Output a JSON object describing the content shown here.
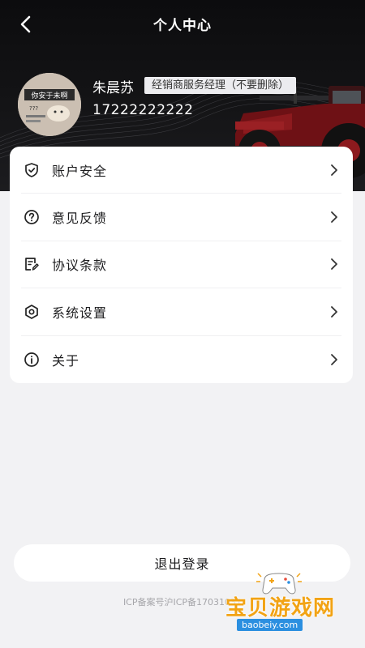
{
  "header": {
    "title": "个人中心",
    "back_icon": "chevron-left-icon"
  },
  "profile": {
    "name": "朱晨苏",
    "role": "经销商服务经理（不要删除）",
    "phone": "17222222222",
    "avatar_text": "你安于未啊",
    "avatar_subtext": "???"
  },
  "menu": {
    "items": [
      {
        "label": "账户安全",
        "icon": "shield-check-icon"
      },
      {
        "label": "意见反馈",
        "icon": "question-circle-icon"
      },
      {
        "label": "协议条款",
        "icon": "document-edit-icon"
      },
      {
        "label": "系统设置",
        "icon": "hexagon-settings-icon"
      },
      {
        "label": "关于",
        "icon": "info-circle-icon"
      }
    ]
  },
  "logout": {
    "label": "退出登录"
  },
  "footer": {
    "icp": "ICP备案号沪ICP备17031031"
  },
  "watermark": {
    "text": "宝贝游戏网",
    "url": "baobeiy.com"
  },
  "colors": {
    "header_bg": "#121214",
    "page_bg": "#f2f2f4",
    "card_bg": "#ffffff",
    "watermark_orange": "#f2a314"
  }
}
